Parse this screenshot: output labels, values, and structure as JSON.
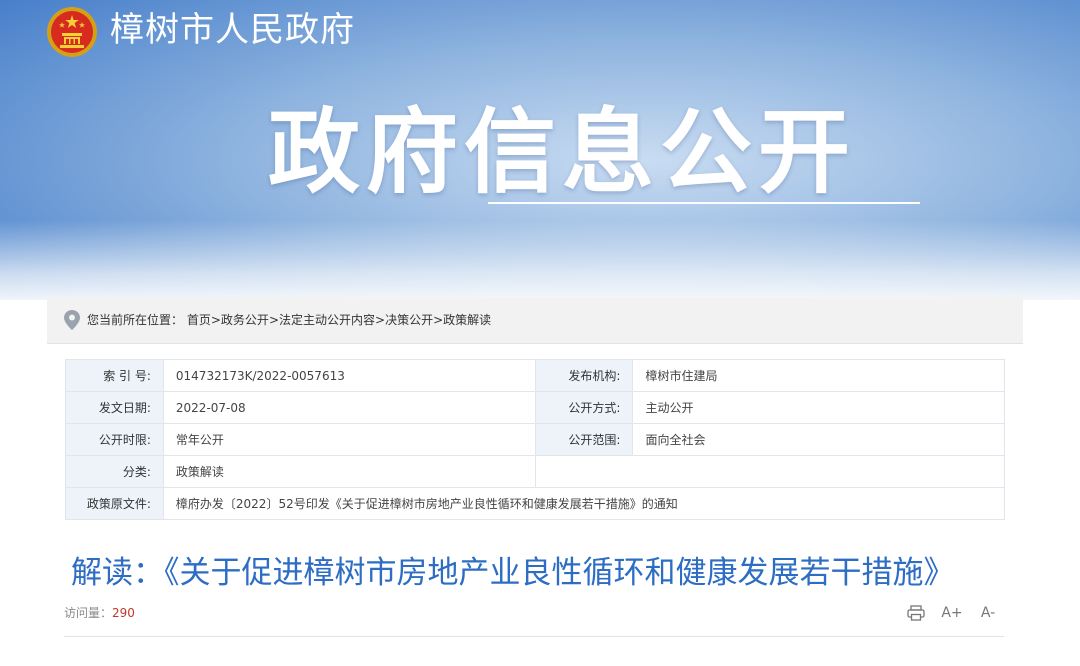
{
  "header": {
    "site_name": "樟树市人民政府",
    "hero_title": "政府信息公开"
  },
  "breadcrumb": {
    "prefix": "您当前所在位置：",
    "items": [
      "首页",
      "政务公开",
      "法定主动公开内容",
      "决策公开",
      "政策解读"
    ],
    "separator": ">"
  },
  "meta": {
    "index_no_label": "索 引 号:",
    "index_no": "014732173K/2022-0057613",
    "publisher_label": "发布机构:",
    "publisher": "樟树市住建局",
    "date_label": "发文日期:",
    "date": "2022-07-08",
    "method_label": "公开方式:",
    "method": "主动公开",
    "period_label": "公开时限:",
    "period": "常年公开",
    "scope_label": "公开范围:",
    "scope": "面向全社会",
    "category_label": "分类:",
    "category": "政策解读",
    "source_label": "政策原文件:",
    "source": "樟府办发〔2022〕52号印发《关于促进樟树市房地产业良性循环和健康发展若干措施》的通知"
  },
  "article": {
    "title": "解读：《关于促进樟树市房地产业良性循环和健康发展若干措施》",
    "visits_label": "访问量：",
    "visits": "290"
  },
  "tools": {
    "print_icon": "printer-icon",
    "font_increase": "A+",
    "font_decrease": "A-"
  },
  "colors": {
    "title_blue": "#2d6dc4",
    "visit_count": "#c0392b",
    "header_blue": "#3f79c8"
  }
}
